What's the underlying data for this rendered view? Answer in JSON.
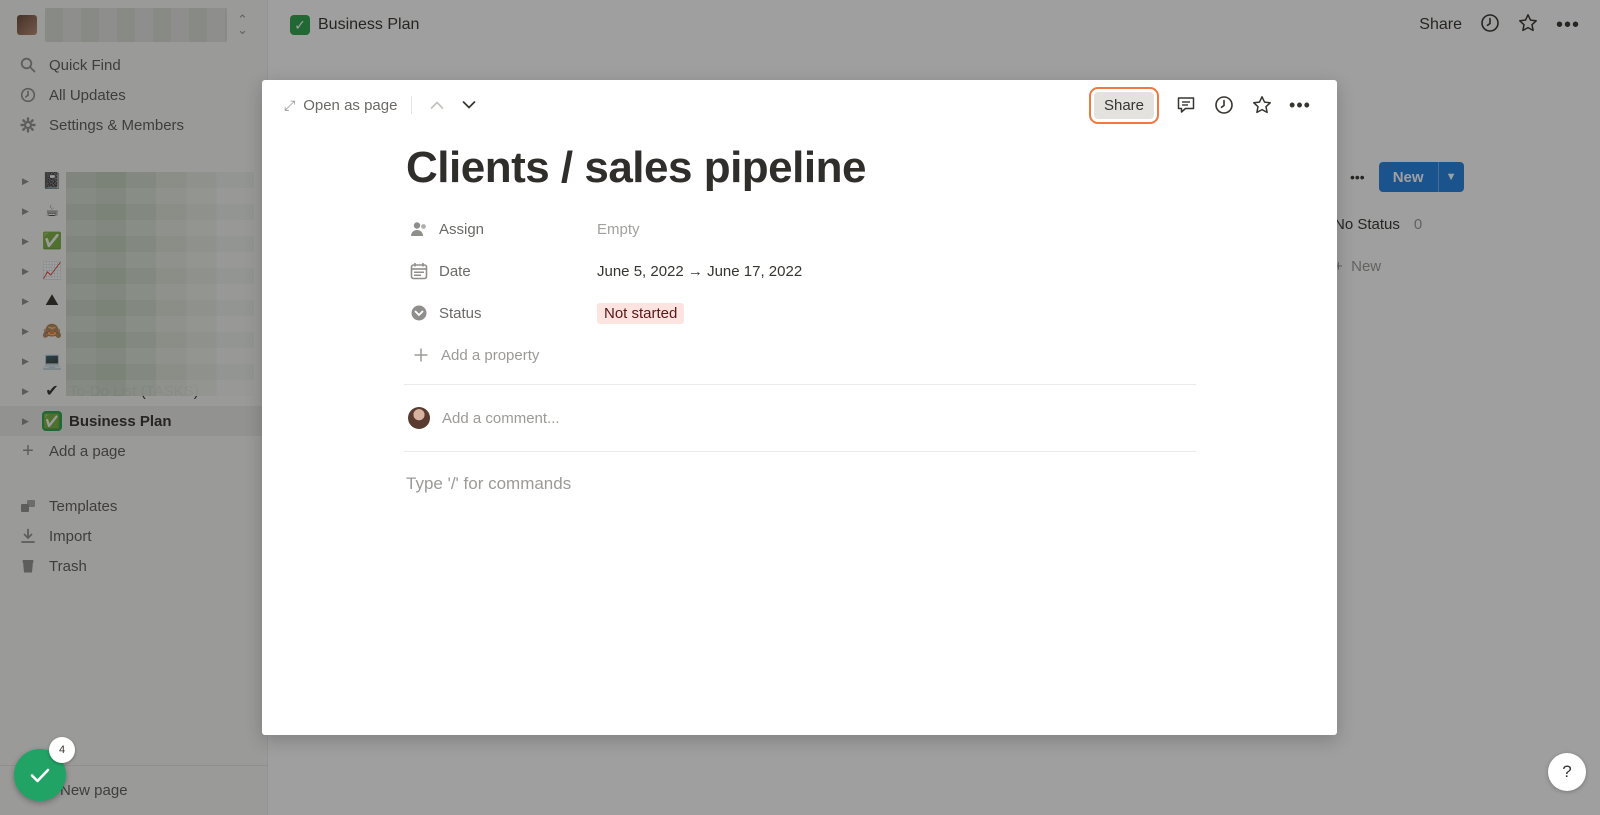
{
  "sidebar": {
    "quick_find": "Quick Find",
    "all_updates": "All Updates",
    "settings": "Settings & Members",
    "pages": [
      {
        "emoji": "📓",
        "label": ""
      },
      {
        "emoji": "☕",
        "label": ""
      },
      {
        "emoji": "✅",
        "label": ""
      },
      {
        "emoji": "📈",
        "label": ""
      },
      {
        "emoji": "⛰",
        "label": ""
      },
      {
        "emoji": "🙈",
        "label": ""
      },
      {
        "emoji": "💻",
        "label": ""
      },
      {
        "emoji": "✔",
        "label": "To-Do List (TASKS)"
      }
    ],
    "active_page": {
      "emoji": "✅",
      "label": "Business Plan"
    },
    "add_page": "Add a page",
    "templates": "Templates",
    "import": "Import",
    "trash": "Trash",
    "new_page": "New page"
  },
  "topbar": {
    "breadcrumb": "Business Plan",
    "share": "Share"
  },
  "board": {
    "new_button": "New",
    "column_title": "No Status",
    "column_count": "0",
    "new_card": "New"
  },
  "modal": {
    "open_as_page": "Open as page",
    "share": "Share",
    "title": "Clients / sales pipeline",
    "properties": [
      {
        "name": "Assign",
        "value": "Empty"
      },
      {
        "name": "Date",
        "value": "June 5, 2022 → June 17, 2022"
      },
      {
        "name": "Status",
        "value": "Not started"
      }
    ],
    "add_property": "Add a property",
    "comment_placeholder": "Add a comment...",
    "body_placeholder": "Type '/' for commands"
  },
  "widgets": {
    "help": "?",
    "fab_badge": "4"
  },
  "colors": {
    "accent_share_highlight": "#ee7a42",
    "status_bg": "#fde4e1",
    "new_button": "#2383e2",
    "fab": "#21a366"
  }
}
